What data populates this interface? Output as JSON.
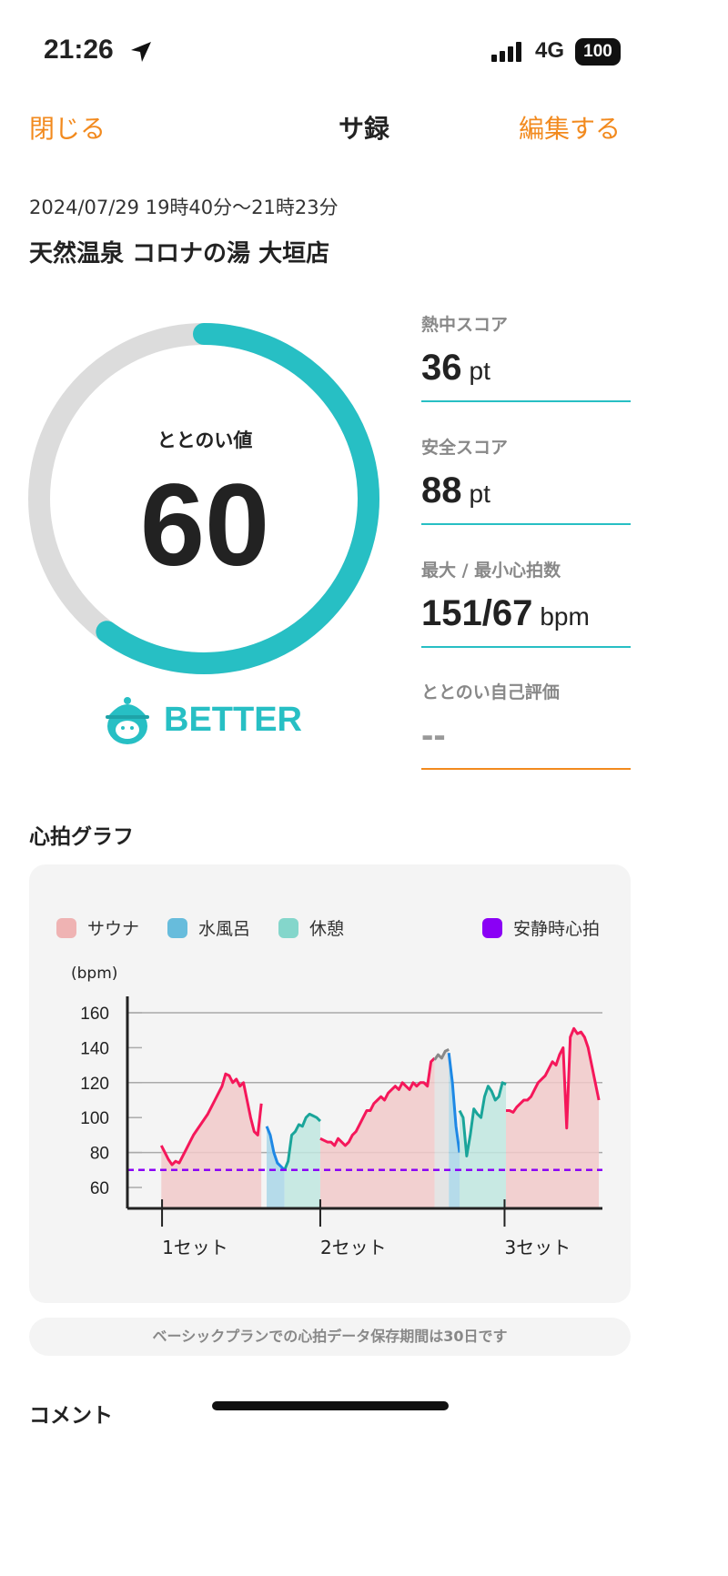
{
  "status_bar": {
    "time": "21:26",
    "network": "4G",
    "battery": "100"
  },
  "nav": {
    "close": "閉じる",
    "title": "サ録",
    "edit": "編集する"
  },
  "session": {
    "datetime": "2024/07/29 19時40分〜21時23分",
    "facility": "天然温泉 コロナの湯 大垣店"
  },
  "totonoi": {
    "label": "ととのい値",
    "value": "60",
    "progress_percent": 60,
    "rating": "BETTER",
    "ring_color": "#27bfc4",
    "track_color": "#dcdcdc"
  },
  "scores": [
    {
      "label": "熱中スコア",
      "value": "36",
      "unit": "pt"
    },
    {
      "label": "安全スコア",
      "value": "88",
      "unit": "pt"
    },
    {
      "label": "最大 / 最小心拍数",
      "value": "151/67",
      "unit": "bpm"
    },
    {
      "label": "ととのい自己評価",
      "value": "--",
      "unit": ""
    }
  ],
  "accent": "#f28a1e",
  "heart_section_title": "心拍グラフ",
  "legend": [
    {
      "label": "サウナ",
      "color": "#efb3b3"
    },
    {
      "label": "水風呂",
      "color": "#67bcdc"
    },
    {
      "label": "休憩",
      "color": "#84d6cb"
    },
    {
      "label": "安静時心拍",
      "color": "#8a00f5"
    }
  ],
  "chart_data": {
    "type": "line",
    "ylabel": "(bpm)",
    "ylim": [
      48,
      170
    ],
    "xlim": [
      0,
      133
    ],
    "yticks": [
      60,
      80,
      100,
      120,
      140,
      160
    ],
    "xticks": [
      {
        "at": 9.7,
        "label": "1セット"
      },
      {
        "at": 54,
        "label": "2セット"
      },
      {
        "at": 105.6,
        "label": "3セット"
      }
    ],
    "resting_hr": 70,
    "segments": [
      {
        "phase": "sauna",
        "start": 9.5,
        "values": [
          84,
          80,
          76,
          73,
          75,
          74,
          78,
          82,
          86,
          90,
          93,
          96,
          99,
          102,
          106,
          110,
          114,
          118,
          125,
          124,
          120,
          122,
          118,
          120,
          110,
          100,
          92,
          90,
          108
        ]
      },
      {
        "phase": "cold",
        "start": 39,
        "values": [
          95,
          90,
          80,
          74,
          72,
          70
        ]
      },
      {
        "phase": "rest",
        "start": 44,
        "values": [
          70,
          75,
          90,
          92,
          96,
          95,
          100,
          102,
          101,
          100,
          98
        ]
      },
      {
        "phase": "sauna",
        "start": 54,
        "values": [
          88,
          87,
          86,
          86,
          84,
          88,
          86,
          84,
          86,
          90,
          92,
          96,
          100,
          104,
          104,
          108,
          110,
          112,
          110,
          114,
          116,
          118,
          116,
          120,
          118,
          116,
          120,
          118,
          120,
          120,
          118,
          132,
          134
        ]
      },
      {
        "phase": "other",
        "start": 86,
        "values": [
          133,
          136,
          134,
          138,
          139
        ]
      },
      {
        "phase": "cold",
        "start": 90,
        "values": [
          137,
          120,
          95,
          80
        ]
      },
      {
        "phase": "rest",
        "start": 93,
        "values": [
          104,
          100,
          78,
          90,
          105,
          102,
          100,
          112,
          118,
          115,
          110,
          112,
          120,
          119
        ]
      },
      {
        "phase": "sauna",
        "start": 106,
        "values": [
          104,
          104,
          103,
          106,
          108,
          110,
          110,
          112,
          116,
          120,
          122,
          124,
          128,
          132,
          130,
          136,
          140,
          94,
          146,
          151,
          148,
          149,
          146,
          140,
          130,
          120,
          110
        ]
      }
    ],
    "colors": {
      "sauna_line": "#f5175a",
      "sauna_fill": "#f1c9c9",
      "cold_line": "#1e88e5",
      "cold_fill": "#a9d6e8",
      "rest_line": "#1aa59a",
      "rest_fill": "#bfe6df",
      "other_line": "#888888",
      "resting_line": "#8a00f5"
    }
  },
  "notice": "ベーシックプランでの心拍データ保存期間は30日です",
  "comment_title": "コメント"
}
